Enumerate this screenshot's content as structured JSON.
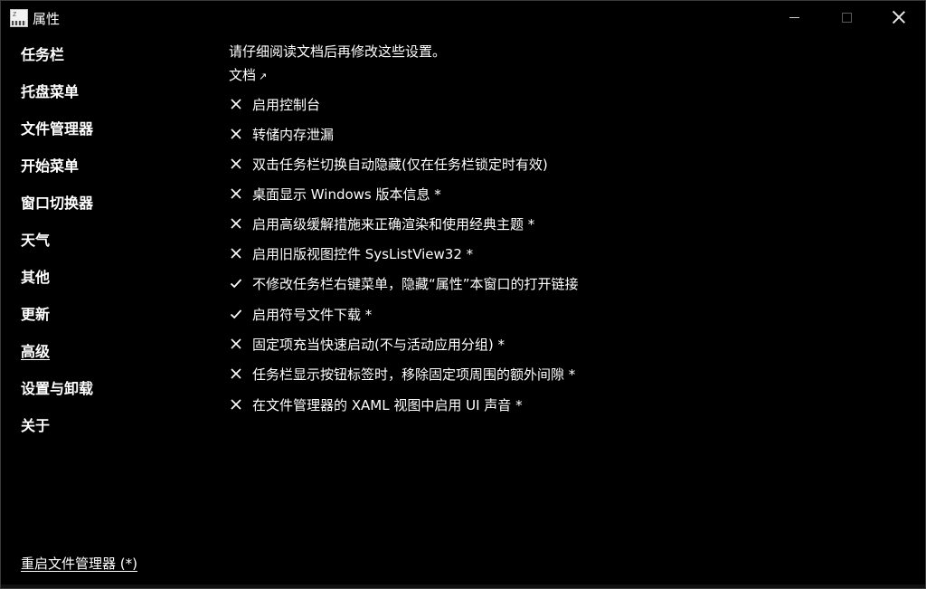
{
  "window": {
    "title": "属性"
  },
  "sidebar": {
    "items": [
      {
        "label": "任务栏"
      },
      {
        "label": "托盘菜单"
      },
      {
        "label": "文件管理器"
      },
      {
        "label": "开始菜单"
      },
      {
        "label": "窗口切换器"
      },
      {
        "label": "天气"
      },
      {
        "label": "其他"
      },
      {
        "label": "更新"
      },
      {
        "label": "高级",
        "active": true
      },
      {
        "label": "设置与卸载"
      },
      {
        "label": "关于"
      }
    ],
    "restart_label": "重启文件管理器 (*)"
  },
  "main": {
    "intro": "请仔细阅读文档后再修改这些设置。",
    "doc_link": "文档",
    "doc_link_icon": "external-link-icon",
    "options": [
      {
        "label": "启用控制台",
        "checked": false
      },
      {
        "label": "转储内存泄漏",
        "checked": false
      },
      {
        "label": "双击任务栏切换自动隐藏(仅在任务栏锁定时有效)",
        "checked": false
      },
      {
        "label": "桌面显示 Windows 版本信息 *",
        "checked": false
      },
      {
        "label": "启用高级缓解措施来正确渲染和使用经典主题 *",
        "checked": false
      },
      {
        "label": "启用旧版视图控件 SysListView32 *",
        "checked": false
      },
      {
        "label": "不修改任务栏右键菜单，隐藏“属性”本窗口的打开链接",
        "checked": true
      },
      {
        "label": "启用符号文件下载 *",
        "checked": true
      },
      {
        "label": "固定项充当快速启动(不与活动应用分组) *",
        "checked": false
      },
      {
        "label": "任务栏显示按钮标签时，移除固定项周围的额外间隙 *",
        "checked": false
      },
      {
        "label": "在文件管理器的 XAML 视图中启用 UI 声音 *",
        "checked": false
      }
    ]
  },
  "colors": {
    "background": "#000000",
    "text": "#ffffff",
    "border": "#3a3a3a"
  }
}
